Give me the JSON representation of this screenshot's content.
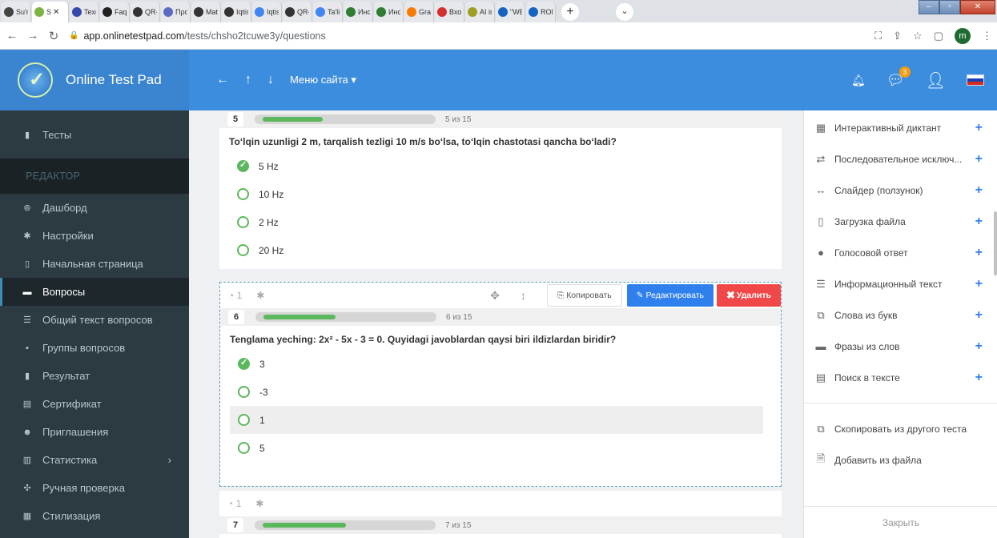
{
  "browser": {
    "tabs": [
      {
        "label": "Su'n",
        "color": "#444444"
      },
      {
        "label": "S",
        "color": "#7cb342",
        "active": true
      },
      {
        "label": "Texn",
        "color": "#3949ab"
      },
      {
        "label": "Faqe",
        "color": "#222222"
      },
      {
        "label": "QR-",
        "color": "#333333"
      },
      {
        "label": "Προ",
        "color": "#5c6bc0"
      },
      {
        "label": "Mat",
        "color": "#333333"
      },
      {
        "label": "Iqtis",
        "color": "#333333"
      },
      {
        "label": "Iqtis",
        "color": "#4285f4"
      },
      {
        "label": "QR-",
        "color": "#333333"
      },
      {
        "label": "Ta'lir",
        "color": "#4285f4"
      },
      {
        "label": "Инс",
        "color": "#2e7d32"
      },
      {
        "label": "Инс",
        "color": "#2e7d32"
      },
      {
        "label": "Grac",
        "color": "#f57c00"
      },
      {
        "label": "Вход",
        "color": "#d32f2f"
      },
      {
        "label": "AI ir",
        "color": "#9e9d24"
      },
      {
        "label": "\"WE",
        "color": "#1565c0"
      },
      {
        "label": "ROE",
        "color": "#1565c0"
      }
    ],
    "url_host": "app.onlinetestpad.com",
    "url_path": "/tests/chsho2tcuwe3y/questions",
    "profile_letter": "m"
  },
  "header": {
    "brand": "Online Test Pad",
    "menu_label": "Меню сайта ▾",
    "chat_badge": "3"
  },
  "sidebar": {
    "tests_label": "Тесты",
    "section_label": "РЕДАКТОР",
    "items": [
      {
        "label": "Дашборд",
        "icon": "dashboard-icon"
      },
      {
        "label": "Настройки",
        "icon": "gear-icon"
      },
      {
        "label": "Начальная страница",
        "icon": "page-icon"
      },
      {
        "label": "Вопросы",
        "icon": "questions-icon",
        "active": true
      },
      {
        "label": "Общий текст вопросов",
        "icon": "text-icon"
      },
      {
        "label": "Группы вопросов",
        "icon": "groups-icon"
      },
      {
        "label": "Результат",
        "icon": "result-icon"
      },
      {
        "label": "Сертификат",
        "icon": "certificate-icon"
      },
      {
        "label": "Приглашения",
        "icon": "invite-icon"
      },
      {
        "label": "Статистика",
        "icon": "stats-icon",
        "chevron": true
      },
      {
        "label": "Ручная проверка",
        "icon": "check-icon"
      },
      {
        "label": "Стилизация",
        "icon": "style-icon"
      }
    ]
  },
  "questions": [
    {
      "number": "5",
      "progress_text": "5 из 15",
      "progress": 0.33,
      "text": "To‘lqin uzunligi 2 m, tarqalish tezligi 10 m/s bo‘lsa, to‘lqin chastotasi qancha bo‘ladi?",
      "answers": [
        "5 Hz",
        "10 Hz",
        "2 Hz",
        "20 Hz"
      ],
      "correct_index": 0
    },
    {
      "number": "6",
      "progress_text": "6 из 15",
      "progress": 0.4,
      "text": "Tenglama yeching: 2x² - 5x - 3 = 0. Quyidagi javoblardan qaysi biri ildizlardan biridir?",
      "answers": [
        "3",
        "-3",
        "1",
        "5"
      ],
      "correct_index": 0,
      "highlight_index": 2,
      "tool_count": "1",
      "copy_label": "Копировать",
      "edit_label": "Редактировать",
      "delete_label": "Удалить"
    },
    {
      "number": "7",
      "progress_text": "7 из 15",
      "progress": 0.46,
      "tool_count": "1"
    }
  ],
  "right_panel": {
    "items": [
      {
        "label": "Интерактивный диктант",
        "icon": "grid-icon"
      },
      {
        "label": "Последовательное исключ...",
        "icon": "sequence-icon"
      },
      {
        "label": "Слайдер (ползунок)",
        "icon": "slider-icon"
      },
      {
        "label": "Загрузка файла",
        "icon": "file-icon"
      },
      {
        "label": "Голосовой ответ",
        "icon": "microphone-icon"
      },
      {
        "label": "Информационный текст",
        "icon": "info-text-icon"
      },
      {
        "label": "Слова из букв",
        "icon": "letters-icon"
      },
      {
        "label": "Фразы из слов",
        "icon": "phrases-icon"
      },
      {
        "label": "Поиск в тексте",
        "icon": "search-text-icon"
      }
    ],
    "copy_from_test": "Скопировать из другого теста",
    "add_from_file": "Добавить из файла",
    "close_label": "Закрыть"
  }
}
